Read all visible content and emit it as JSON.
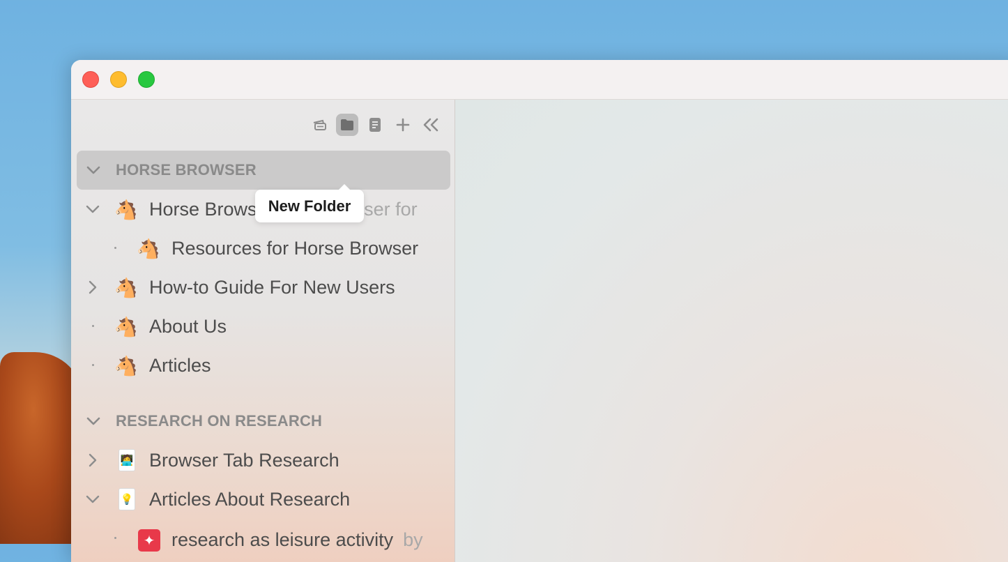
{
  "window": {
    "traffic_lights": [
      "close",
      "minimize",
      "maximize"
    ]
  },
  "toolbar": {
    "buttons": [
      {
        "name": "cards-icon"
      },
      {
        "name": "folder-icon",
        "active": true
      },
      {
        "name": "note-icon"
      },
      {
        "name": "plus-icon"
      },
      {
        "name": "collapse-sidebar-icon"
      }
    ],
    "tooltip": "New Folder"
  },
  "sidebar": {
    "sections": [
      {
        "header": "HORSE BROWSER",
        "selected": true,
        "items": [
          {
            "title": "Horse Browser",
            "subtitle": "The Browser for",
            "icon": "🐴",
            "disclosure": "expanded"
          },
          {
            "title": "Resources for Horse Browser",
            "icon": "🐴",
            "disclosure": "leaf"
          },
          {
            "title": "How-to Guide For New Users",
            "icon": "🐴",
            "disclosure": "collapsed"
          },
          {
            "title": "About Us",
            "icon": "🐴",
            "disclosure": "leaf"
          },
          {
            "title": "Articles",
            "icon": "🐴",
            "disclosure": "leaf"
          }
        ]
      },
      {
        "header": "RESEARCH ON RESEARCH",
        "selected": false,
        "items": [
          {
            "title": "Browser Tab Research",
            "icon": "🧑‍💻",
            "disclosure": "collapsed"
          },
          {
            "title": "Articles About Research",
            "icon": "💡",
            "disclosure": "expanded"
          },
          {
            "title": "research as leisure activity",
            "subtitle": "by",
            "icon": "✦",
            "disclosure": "leaf"
          }
        ]
      }
    ]
  }
}
